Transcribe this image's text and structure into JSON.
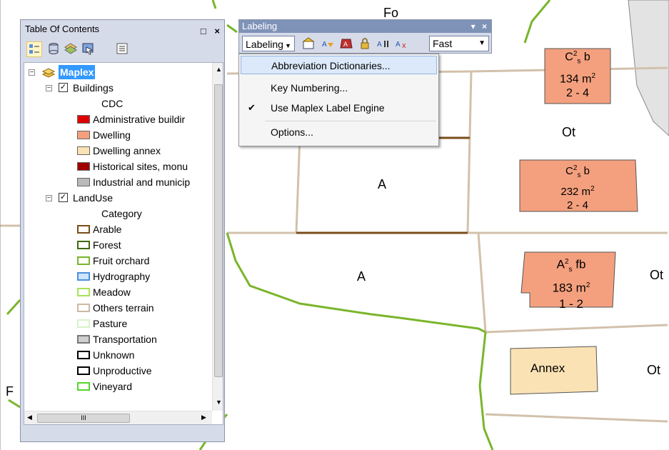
{
  "toc": {
    "title": "Table Of Contents",
    "close_label": "×",
    "pin_label": "□",
    "items": {
      "maplex": "Maplex",
      "buildings": "Buildings",
      "buildings_field": "CDC",
      "admin": "Administrative buildir",
      "dwelling": "Dwelling",
      "annex": "Dwelling annex",
      "historical": "Historical sites, monu",
      "industrial": "Industrial and municip",
      "landuse": "LandUse",
      "landuse_field": "Category",
      "arable": "Arable",
      "forest": "Forest",
      "orchard": "Fruit orchard",
      "hydro": "Hydrography",
      "meadow": "Meadow",
      "others": "Others terrain",
      "pasture": "Pasture",
      "transport": "Transportation",
      "unknown": "Unknown",
      "unproductive": "Unproductive",
      "vineyard": "Vineyard"
    },
    "colors": {
      "admin": "#e00000",
      "dwelling": "#f4a07e",
      "annex": "#fbe2b4",
      "historical": "#a00000",
      "industrial": "#b9b9b9",
      "arable": "#7a4c1a",
      "forest": "#3f6b10",
      "orchard": "#7ab52b",
      "hydro": "#4a90e0",
      "meadow": "#a7e35a",
      "others": "#cdb9a2",
      "pasture": "#d8f3c8",
      "transport": "#9a9a9a",
      "unknown": "#000000",
      "unproductive": "#000000",
      "vineyard": "#55d62a"
    },
    "scroll_label": "III"
  },
  "labeling": {
    "title": "Labeling",
    "menu_label": "Labeling",
    "speed": "Fast",
    "menu": {
      "abbrev": "Abbreviation Dictionaries...",
      "keynum": "Key Numbering...",
      "maplex": "Use Maplex Label Engine",
      "options": "Options..."
    }
  },
  "map": {
    "top_label": "Fo",
    "parcel_a1": "A",
    "parcel_a2": "A",
    "ot1": "Ot",
    "ot2": "Ot",
    "ot3": "Ot",
    "f_label": "F",
    "annex": "Annex",
    "b1": {
      "code": "C",
      "sup": "2",
      "sub": "s",
      "suffix": " b",
      "area": "134 m",
      "area_sup": "2",
      "floors": "2 - 4"
    },
    "b2": {
      "code": "C",
      "sup": "2",
      "sub": "s",
      "suffix": " b",
      "area": "232 m",
      "area_sup": "2",
      "floors": "2 - 4"
    },
    "b3": {
      "code": "A",
      "sup": "2",
      "sub": "s",
      "suffix": " fb",
      "area": "183 m",
      "area_sup": "2",
      "floors": "1 - 2"
    }
  }
}
